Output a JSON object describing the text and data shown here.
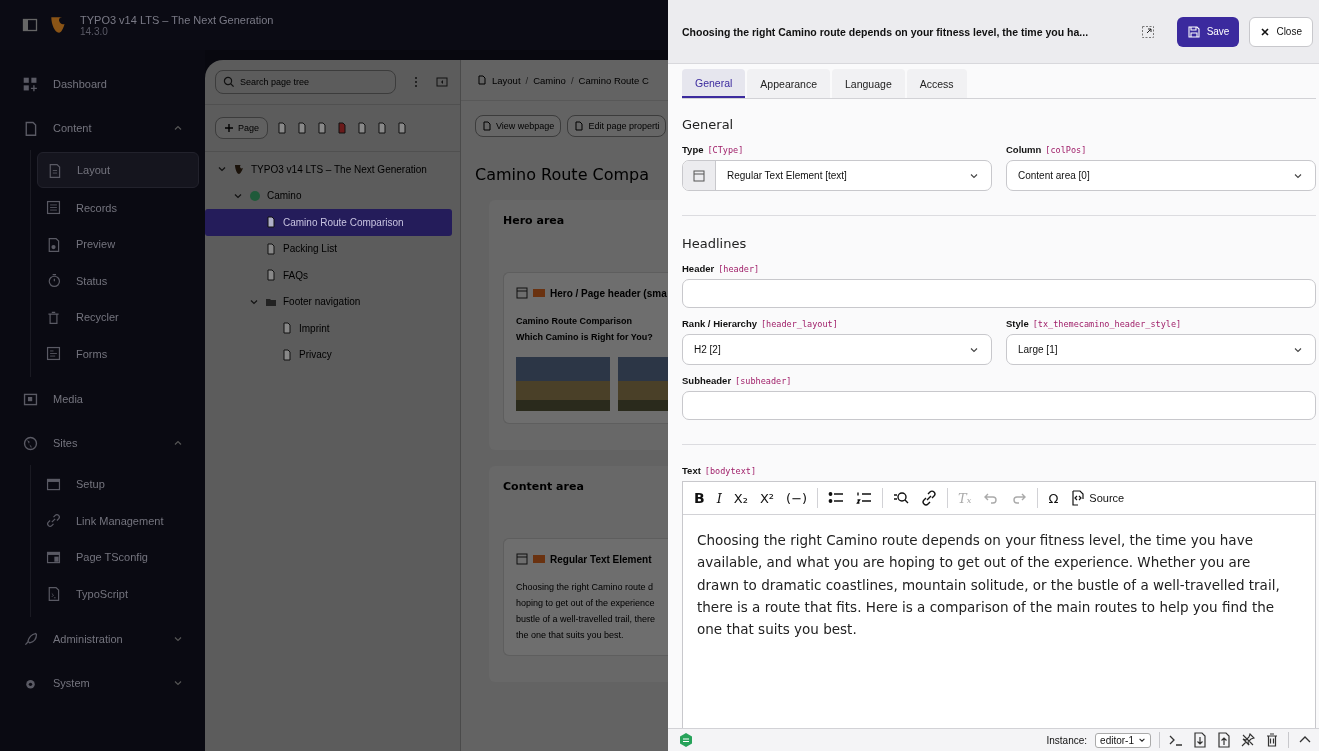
{
  "topbar": {
    "title": "TYPO3 v14 LTS – The Next Generation",
    "version": "14.3.0"
  },
  "sidebar": {
    "groups": [
      {
        "label": "Dashboard"
      },
      {
        "label": "Content",
        "expanded": true,
        "children": [
          {
            "label": "Layout",
            "selected": true
          },
          {
            "label": "Records",
            "selected": false
          },
          {
            "label": "Preview",
            "selected": false
          },
          {
            "label": "Status",
            "selected": false
          },
          {
            "label": "Recycler",
            "selected": false
          },
          {
            "label": "Forms",
            "selected": false
          }
        ]
      },
      {
        "label": "Media"
      },
      {
        "label": "Sites",
        "expanded": true,
        "children": [
          {
            "label": "Setup",
            "selected": false
          },
          {
            "label": "Link Management",
            "selected": false
          },
          {
            "label": "Page TSconfig",
            "selected": false
          },
          {
            "label": "TypoScript",
            "selected": false
          }
        ]
      },
      {
        "label": "Administration",
        "expanded": false
      },
      {
        "label": "System",
        "expanded": false
      }
    ]
  },
  "page_tree": {
    "search": {
      "placeholder": "Search page tree"
    },
    "new_page_button": "Page",
    "nodes": [
      {
        "label": "TYPO3 v14 LTS – The Next Generation",
        "kind": "root",
        "expanded": true,
        "selected": false,
        "children": [
          {
            "label": "Camino",
            "kind": "site",
            "expanded": true,
            "selected": false,
            "children": [
              {
                "label": "Camino Route Comparison",
                "kind": "page",
                "selected": true
              },
              {
                "label": "Packing List",
                "kind": "page",
                "selected": false
              },
              {
                "label": "FAQs",
                "kind": "page",
                "selected": false
              },
              {
                "label": "Footer navigation",
                "kind": "folder",
                "expanded": true,
                "selected": false,
                "children": [
                  {
                    "label": "Imprint",
                    "kind": "page",
                    "selected": false
                  },
                  {
                    "label": "Privacy",
                    "kind": "page",
                    "selected": false
                  }
                ]
              }
            ]
          }
        ]
      }
    ]
  },
  "content": {
    "breadcrumb": [
      {
        "kind": "link",
        "label": "Layout"
      },
      {
        "kind": "separator",
        "label": "/"
      },
      {
        "kind": "link",
        "label": "Camino"
      },
      {
        "kind": "separator",
        "label": "/"
      },
      {
        "kind": "link",
        "label": "Camino Route C"
      }
    ],
    "buttons": [
      "View webpage",
      "Edit page properti"
    ],
    "heading": "Camino Route Compa",
    "areas": [
      {
        "title": "Hero area",
        "element": {
          "kind": "hero",
          "title": "Hero / Page header (sma",
          "lines": [
            "Camino Route Comparison",
            "Which Camino is Right for You?"
          ]
        }
      },
      {
        "title": "Content area",
        "element": {
          "kind": "text",
          "title": "Regular Text Element",
          "lines": [
            "Choosing the right Camino route d",
            "hoping to get out of the experience",
            "bustle of a well-travelled trail, there",
            "the one that suits you best."
          ]
        }
      }
    ]
  },
  "modal": {
    "title": "Choosing the right Camino route depends on your fitness level, the time you ha...",
    "save": "Save",
    "close": "Close",
    "tabs": [
      {
        "label": "General",
        "selected": true
      },
      {
        "label": "Appearance",
        "selected": false
      },
      {
        "label": "Language",
        "selected": false
      },
      {
        "label": "Access",
        "selected": false
      }
    ],
    "sections": [
      {
        "title": "General",
        "rows": [
          [
            {
              "label": "Type",
              "field": "[CType]",
              "kind": "select",
              "value": "Regular Text Element [text]",
              "icon": true
            },
            {
              "label": "Column",
              "field": "[colPos]",
              "kind": "select",
              "value": "Content area [0]",
              "icon": false
            }
          ]
        ]
      },
      {
        "title": "Headlines",
        "rows": [
          [
            {
              "label": "Header",
              "field": "[header]",
              "kind": "input"
            }
          ],
          [
            {
              "label": "Rank / Hierarchy",
              "field": "[header_layout]",
              "kind": "select",
              "value": "H2 [2]",
              "icon": false
            },
            {
              "label": "Style",
              "field": "[tx_themecamino_header_style]",
              "kind": "select",
              "value": "Large [1]",
              "icon": false
            }
          ],
          [
            {
              "label": "Subheader",
              "field": "[subheader]",
              "kind": "input"
            }
          ]
        ]
      }
    ],
    "text_field": {
      "label": "Text",
      "field": "[bodytext]",
      "toolbar": [
        {
          "kind": "bold",
          "text": "B",
          "disabled": false
        },
        {
          "kind": "italic",
          "text": "I",
          "disabled": false
        },
        {
          "kind": "subscript",
          "text": "X₂",
          "disabled": false
        },
        {
          "kind": "superscript",
          "text": "X²",
          "disabled": false
        },
        {
          "kind": "code",
          "text": "(−)",
          "disabled": false
        },
        {
          "kind": "separator"
        },
        {
          "kind": "bullets",
          "disabled": false
        },
        {
          "kind": "numbers",
          "disabled": false
        },
        {
          "kind": "separator"
        },
        {
          "kind": "find",
          "disabled": false
        },
        {
          "kind": "link",
          "disabled": false
        },
        {
          "kind": "separator"
        },
        {
          "kind": "clear_format",
          "text": "Tₓ",
          "disabled": true
        },
        {
          "kind": "undo",
          "disabled": true
        },
        {
          "kind": "redo",
          "disabled": true
        },
        {
          "kind": "separator"
        },
        {
          "kind": "special_char",
          "text": "Ω",
          "disabled": false
        },
        {
          "kind": "source",
          "text": "Source",
          "disabled": false
        }
      ],
      "value": "Choosing the right Camino route depends on your fitness level, the time you have available, and what you are hoping to get out of the experience. Whether you are drawn to dramatic coastlines, mountain solitude, or the bustle of a well-travelled trail, there is a route that fits. Here is a comparison of the main routes to help you find the one that suits you best."
    },
    "footer": {
      "instance_label": "Instance:",
      "instance_value": "editor-1"
    }
  }
}
